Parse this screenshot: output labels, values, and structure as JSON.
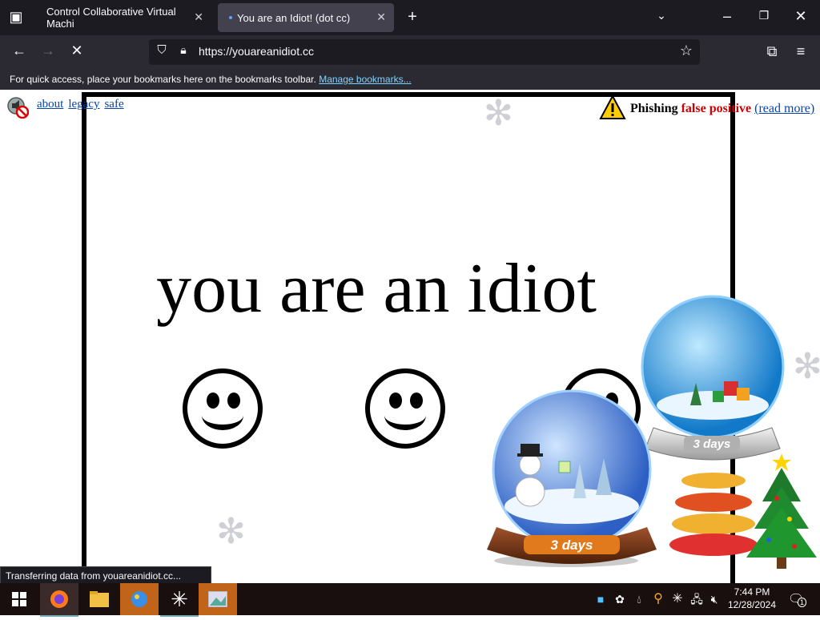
{
  "browser": {
    "tabs": [
      {
        "label": "Control Collaborative Virtual Machi"
      },
      {
        "label": "You are an Idiot! (dot cc)"
      }
    ],
    "url": "https://youareanidiot.cc",
    "bookmarks_text": "For quick access, place your bookmarks here on the bookmarks toolbar.",
    "bookmarks_link": "Manage bookmarks..."
  },
  "page": {
    "links": [
      "about",
      "legacy",
      "safe"
    ],
    "phishing": {
      "word1": "Phishing",
      "word2": "false positive",
      "link": "(read more)"
    },
    "headline": "you are an idiot",
    "globe_badge": "3 days"
  },
  "status_text": "Transferring data from youareanidiot.cc...",
  "taskbar": {
    "time": "7:44 PM",
    "date": "12/28/2024",
    "notification_count": "1"
  }
}
